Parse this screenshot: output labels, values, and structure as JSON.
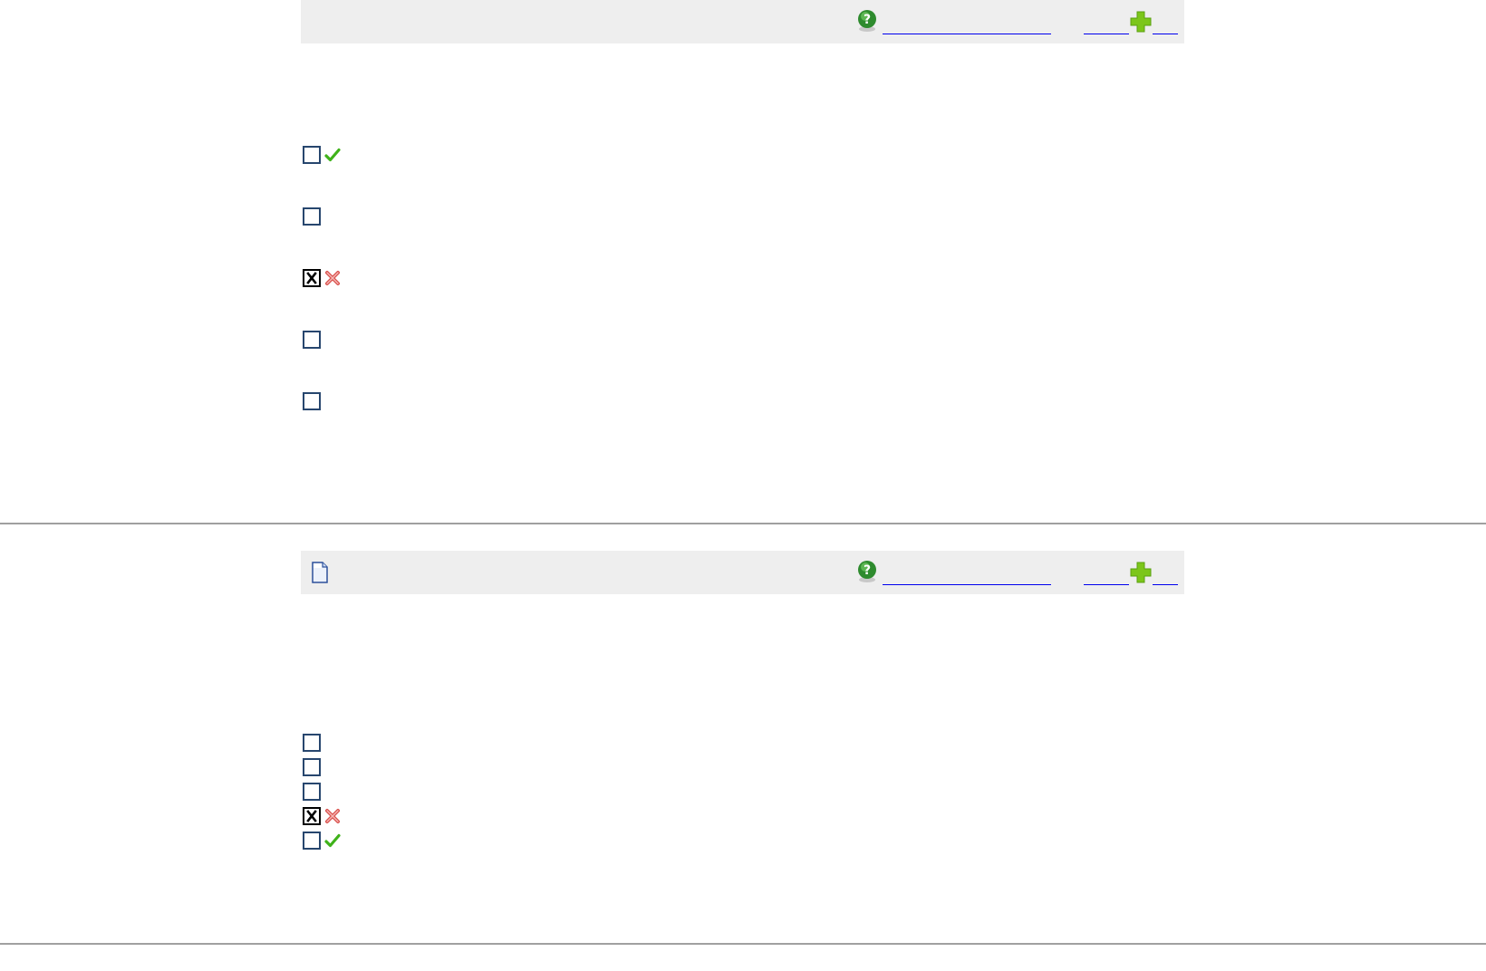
{
  "question1": {
    "toolbar": {
      "help_link_text": "",
      "link_a_text": "",
      "link_b_text": ""
    },
    "options": [
      {
        "label": "",
        "checked": false,
        "result": "correct"
      },
      {
        "label": "",
        "checked": false,
        "result": "none"
      },
      {
        "label": "",
        "checked": true,
        "result": "incorrect"
      },
      {
        "label": "",
        "checked": false,
        "result": "none"
      },
      {
        "label": "",
        "checked": false,
        "result": "none"
      }
    ]
  },
  "question2": {
    "toolbar": {
      "help_link_text": "",
      "link_a_text": "",
      "link_b_text": ""
    },
    "options": [
      {
        "label": "",
        "checked": false,
        "result": "none"
      },
      {
        "label": "",
        "checked": false,
        "result": "none"
      },
      {
        "label": "",
        "checked": false,
        "result": "none"
      },
      {
        "label": "",
        "checked": true,
        "result": "incorrect"
      },
      {
        "label": "",
        "checked": false,
        "result": "correct"
      }
    ]
  },
  "colors": {
    "toolbar_bg": "#eeeeee",
    "link": "#0000ee",
    "correct": "#3fb21a",
    "incorrect": "#d9534f"
  }
}
